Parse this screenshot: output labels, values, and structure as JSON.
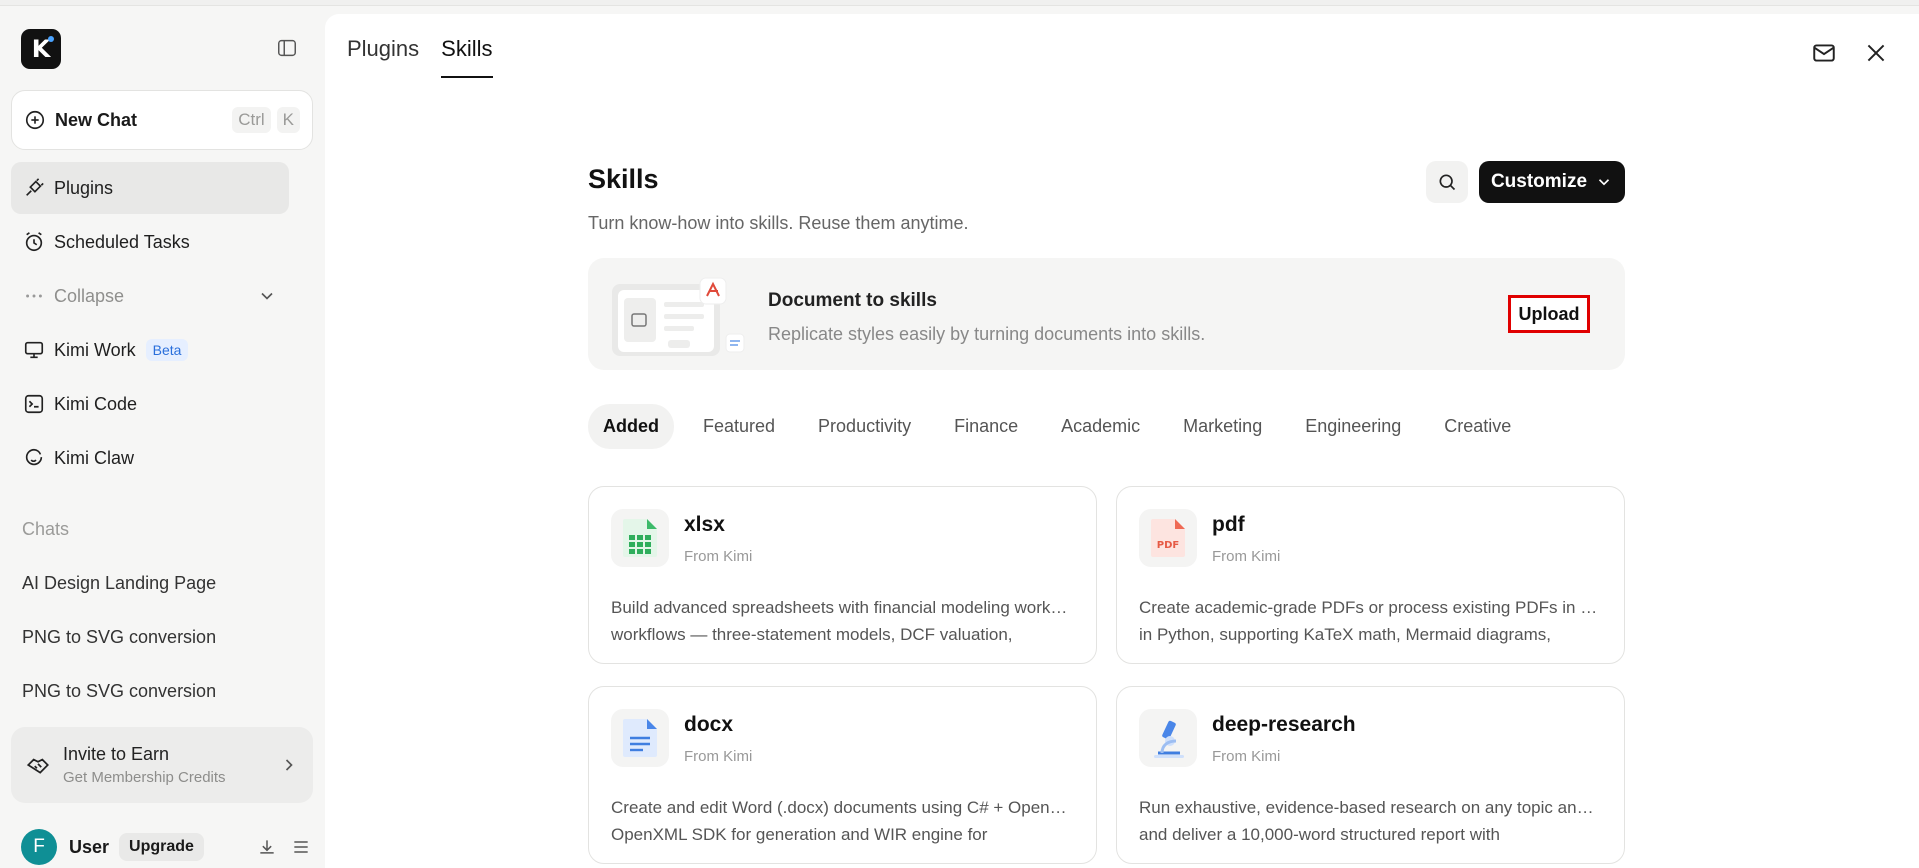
{
  "sidebar": {
    "logo_letter": "K",
    "new_chat": {
      "label": "New Chat",
      "kbd1": "Ctrl",
      "kbd2": "K"
    },
    "nav": [
      {
        "label": "Plugins"
      },
      {
        "label": "Scheduled Tasks"
      },
      {
        "label": "Collapse"
      },
      {
        "label": "Kimi Work",
        "badge": "Beta"
      },
      {
        "label": "Kimi Code"
      },
      {
        "label": "Kimi Claw"
      }
    ],
    "chats_label": "Chats",
    "chats": [
      "AI Design Landing Page",
      "PNG to SVG conversion",
      "PNG to SVG conversion"
    ],
    "invite": {
      "title": "Invite to Earn",
      "subtitle": "Get Membership Credits"
    },
    "user": {
      "initial": "F",
      "name": "User",
      "upgrade": "Upgrade"
    }
  },
  "main": {
    "tabs": [
      "Plugins",
      "Skills"
    ],
    "title": "Skills",
    "subtitle": "Turn know-how into skills. Reuse them anytime.",
    "customize_label": "Customize",
    "banner": {
      "title": "Document to skills",
      "subtitle": "Replicate styles easily by turning documents into skills.",
      "upload_label": "Upload"
    },
    "categories": [
      "Added",
      "Featured",
      "Productivity",
      "Finance",
      "Academic",
      "Marketing",
      "Engineering",
      "Creative"
    ],
    "cards": [
      {
        "name": "xlsx",
        "source": "From Kimi",
        "line1": "Build advanced spreadsheets with financial modeling workflows — three-statement models, DCF valuation,",
        "line2": "workflows — three-statement models, DCF valuation,"
      },
      {
        "name": "pdf",
        "source": "From Kimi",
        "line1": "Create academic-grade PDFs or process existing PDFs in Python, supporting KaTeX math, Mermaid diagrams,",
        "line2": "in Python, supporting KaTeX math, Mermaid diagrams,"
      },
      {
        "name": "docx",
        "source": "From Kimi",
        "line1": "Create and edit Word (.docx) documents using C# + OpenXML SDK for generation and WIR engine for",
        "line2": "OpenXML SDK for generation and WIR engine for"
      },
      {
        "name": "deep-research",
        "source": "From Kimi",
        "line1": "Run exhaustive, evidence-based research on any topic and deliver a 10,000-word structured report with",
        "line2": "and deliver a 10,000-word structured report with"
      }
    ]
  },
  "colors": {
    "accent": "#111111",
    "upload_highlight": "#e00000",
    "beta": "#2a6fdb",
    "avatar": "#0f8f95"
  }
}
